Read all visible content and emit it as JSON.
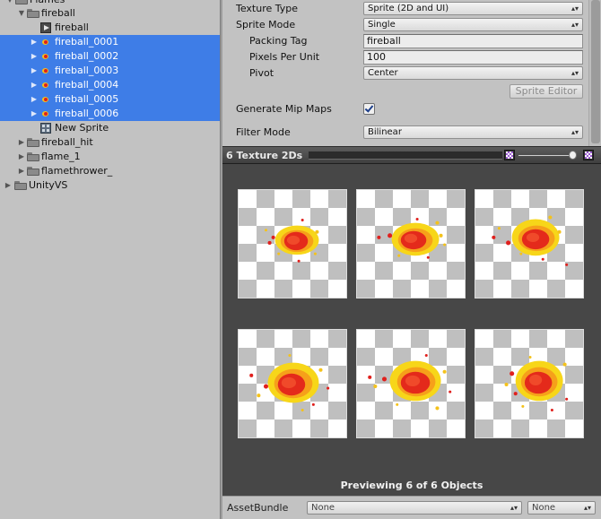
{
  "tree": {
    "rows": [
      {
        "label": "Flames",
        "icon": "folder-icon",
        "selected": false
      },
      {
        "label": "fireball",
        "icon": "folder-icon",
        "selected": false
      },
      {
        "label": "fireball",
        "icon": "sprite-texture-icon",
        "selected": false
      },
      {
        "label": "fireball_0001",
        "icon": "sprite-icon",
        "selected": true
      },
      {
        "label": "fireball_0002",
        "icon": "sprite-icon",
        "selected": true
      },
      {
        "label": "fireball_0003",
        "icon": "sprite-icon",
        "selected": true
      },
      {
        "label": "fireball_0004",
        "icon": "sprite-icon",
        "selected": true
      },
      {
        "label": "fireball_0005",
        "icon": "sprite-icon",
        "selected": true
      },
      {
        "label": "fireball_0006",
        "icon": "sprite-icon",
        "selected": true
      },
      {
        "label": "New Sprite",
        "icon": "grid-icon",
        "selected": false
      },
      {
        "label": "fireball_hit",
        "icon": "folder-icon",
        "selected": false
      },
      {
        "label": "flame_1",
        "icon": "folder-icon",
        "selected": false
      },
      {
        "label": "flamethrower_",
        "icon": "folder-icon",
        "selected": false
      },
      {
        "label": "UnityVS",
        "icon": "folder-icon",
        "selected": false
      }
    ]
  },
  "inspector": {
    "texture_type": {
      "label": "Texture Type",
      "value": "Sprite (2D and UI)"
    },
    "sprite_mode": {
      "label": "Sprite Mode",
      "value": "Single"
    },
    "packing_tag": {
      "label": "Packing Tag",
      "value": "fireball"
    },
    "pixels_per_unit": {
      "label": "Pixels Per Unit",
      "value": "100"
    },
    "pivot": {
      "label": "Pivot",
      "value": "Center"
    },
    "sprite_editor_button": "Sprite Editor",
    "generate_mip_maps": {
      "label": "Generate Mip Maps",
      "checked": true
    },
    "filter_mode": {
      "label": "Filter Mode",
      "value": "Bilinear"
    }
  },
  "preview": {
    "title": "6 Texture 2Ds",
    "thumbnails": [
      "fireball_0001",
      "fireball_0002",
      "fireball_0003",
      "fireball_0004",
      "fireball_0005",
      "fireball_0006"
    ],
    "status": "Previewing 6 of 6 Objects",
    "icons": [
      "mix-channels-icon",
      "alpha-icon",
      "zoom-slider",
      "tag-icon"
    ]
  },
  "asset_bundle": {
    "label": "AssetBundle",
    "name": "None",
    "variant": "None"
  },
  "colors": {
    "selection": "#3e7de7",
    "panel_bg": "#c2c2c2",
    "preview_bg": "#474747",
    "fire_red": "#e0201d",
    "fire_yellow": "#f4c21b"
  }
}
